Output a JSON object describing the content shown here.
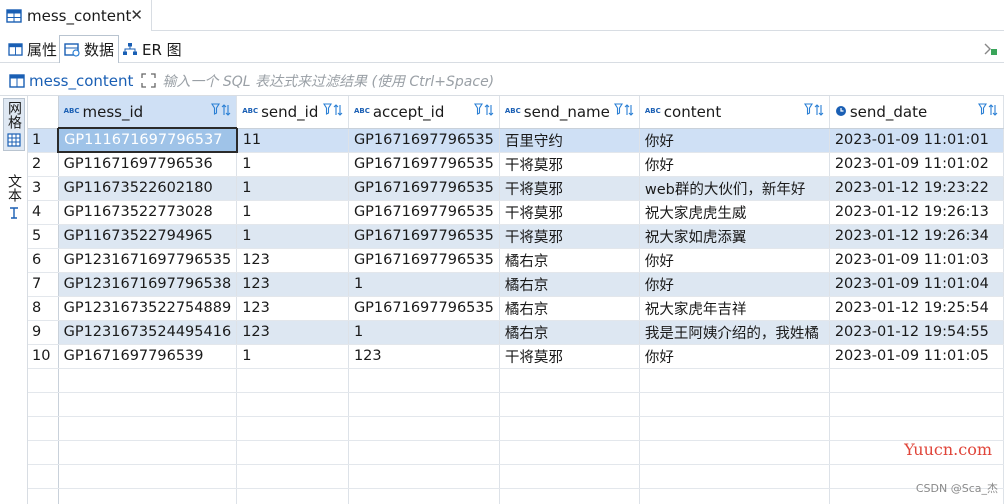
{
  "tab": {
    "title": "mess_content",
    "close": "✕"
  },
  "subtabs": [
    {
      "label": "属性"
    },
    {
      "label": "数据"
    },
    {
      "label": "ER 图"
    }
  ],
  "filter": {
    "table_name": "mess_content",
    "placeholder": "输入一个 SQL 表达式来过滤结果 (使用 Ctrl+Space)"
  },
  "side_tabs": [
    {
      "label": "网格"
    },
    {
      "label": "文本"
    }
  ],
  "grid": {
    "columns": [
      {
        "name": "mess_id",
        "type": "ABC"
      },
      {
        "name": "send_id",
        "type": "ABC"
      },
      {
        "name": "accept_id",
        "type": "ABC"
      },
      {
        "name": "send_name",
        "type": "ABC"
      },
      {
        "name": "content",
        "type": "ABC"
      },
      {
        "name": "send_date",
        "type": "date"
      }
    ],
    "rows": [
      {
        "n": "1",
        "cells": [
          "GP11167169779653​7",
          "11",
          "GP1671697796535",
          "百里守约",
          "你好",
          "2023-01-09 11:01:01"
        ]
      },
      {
        "n": "2",
        "cells": [
          "GP11671697796536",
          "1",
          "GP1671697796535",
          "干将莫邪",
          "你好",
          "2023-01-09 11:01:02"
        ]
      },
      {
        "n": "3",
        "cells": [
          "GP11673522602180",
          "1",
          "GP1671697796535",
          "干将莫邪",
          "web群的大伙们，新年好",
          "2023-01-12 19:23:22"
        ]
      },
      {
        "n": "4",
        "cells": [
          "GP11673522773028",
          "1",
          "GP1671697796535",
          "干将莫邪",
          "祝大家虎虎生威",
          "2023-01-12 19:26:13"
        ]
      },
      {
        "n": "5",
        "cells": [
          "GP11673522794965",
          "1",
          "GP1671697796535",
          "干将莫邪",
          "祝大家如虎添翼",
          "2023-01-12 19:26:34"
        ]
      },
      {
        "n": "6",
        "cells": [
          "GP1231671697796535",
          "123",
          "GP1671697796535",
          "橘右京",
          "你好",
          "2023-01-09 11:01:03"
        ]
      },
      {
        "n": "7",
        "cells": [
          "GP1231671697796538",
          "123",
          "1",
          "橘右京",
          "你好",
          "2023-01-09 11:01:04"
        ]
      },
      {
        "n": "8",
        "cells": [
          "GP1231673522754889",
          "123",
          "GP1671697796535",
          "橘右京",
          "祝大家虎年吉祥",
          "2023-01-12 19:25:54"
        ]
      },
      {
        "n": "9",
        "cells": [
          "GP1231673524495416",
          "123",
          "1",
          "橘右京",
          "我是王阿姨介绍的，我姓橘",
          "2023-01-12 19:54:55"
        ]
      },
      {
        "n": "10",
        "cells": [
          "GP1671697796539",
          "1",
          "123",
          "干将莫邪",
          "你好",
          "2023-01-09 11:01:05"
        ]
      }
    ]
  },
  "watermark": "Yuucn.com",
  "credit": "CSDN @Sca_杰",
  "colors": {
    "accent": "#1a5fb4",
    "selected": "#cfe0f5",
    "alt_row": "#dde7f2"
  }
}
